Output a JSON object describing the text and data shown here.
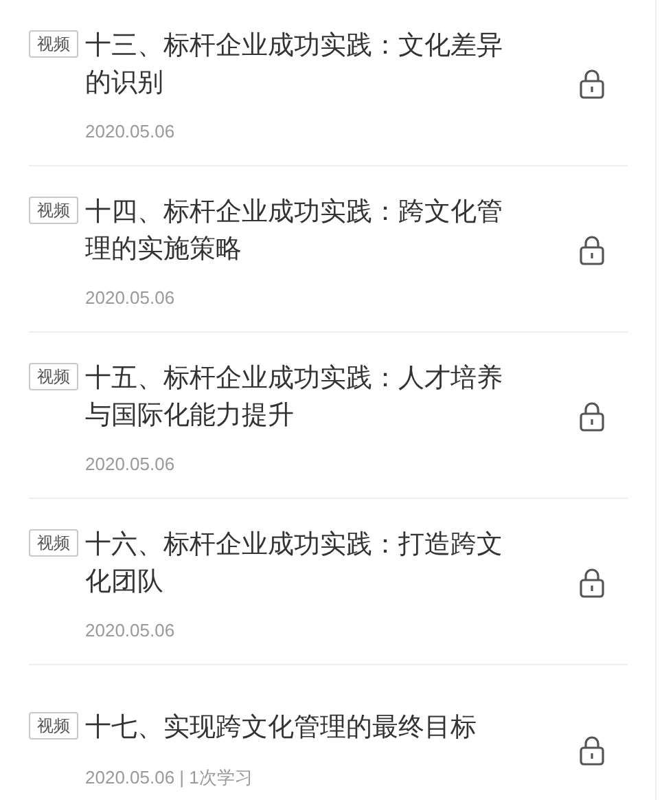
{
  "lessons": [
    {
      "tag": "视频",
      "title": "十三、标杆企业成功实践：文化差异的识别",
      "meta": "2020.05.06",
      "locked": true
    },
    {
      "tag": "视频",
      "title": "十四、标杆企业成功实践：跨文化管理的实施策略",
      "meta": "2020.05.06",
      "locked": true
    },
    {
      "tag": "视频",
      "title": "十五、标杆企业成功实践：人才培养与国际化能力提升",
      "meta": "2020.05.06",
      "locked": true
    },
    {
      "tag": "视频",
      "title": "十六、标杆企业成功实践：打造跨文化团队",
      "meta": "2020.05.06",
      "locked": true
    },
    {
      "tag": "视频",
      "title": "十七、实现跨文化管理的最终目标",
      "meta": "2020.05.06 | 1次学习",
      "locked": true
    }
  ]
}
